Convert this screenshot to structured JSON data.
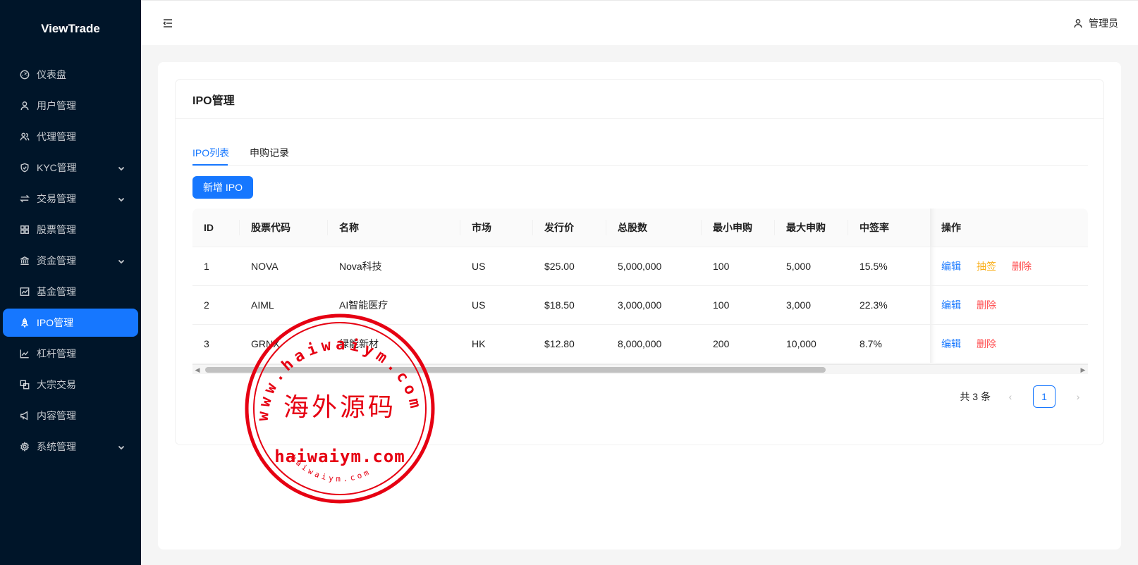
{
  "app": {
    "logo": "ViewTrade"
  },
  "sidebar": {
    "items": [
      {
        "label": "仪表盘",
        "icon": "dashboard-icon",
        "expandable": false,
        "active": false
      },
      {
        "label": "用户管理",
        "icon": "user-icon",
        "expandable": false,
        "active": false
      },
      {
        "label": "代理管理",
        "icon": "agent-icon",
        "expandable": false,
        "active": false
      },
      {
        "label": "KYC管理",
        "icon": "shield-icon",
        "expandable": true,
        "active": false
      },
      {
        "label": "交易管理",
        "icon": "swap-icon",
        "expandable": true,
        "active": false
      },
      {
        "label": "股票管理",
        "icon": "grid-icon",
        "expandable": false,
        "active": false
      },
      {
        "label": "资金管理",
        "icon": "bank-icon",
        "expandable": true,
        "active": false
      },
      {
        "label": "基金管理",
        "icon": "chart-icon",
        "expandable": false,
        "active": false
      },
      {
        "label": "IPO管理",
        "icon": "rocket-icon",
        "expandable": false,
        "active": true
      },
      {
        "label": "杠杆管理",
        "icon": "line-chart-icon",
        "expandable": false,
        "active": false
      },
      {
        "label": "大宗交易",
        "icon": "block-icon",
        "expandable": false,
        "active": false
      },
      {
        "label": "内容管理",
        "icon": "notification-icon",
        "expandable": false,
        "active": false
      },
      {
        "label": "系统管理",
        "icon": "setting-icon",
        "expandable": true,
        "active": false
      }
    ]
  },
  "header": {
    "user_label": "管理员"
  },
  "page": {
    "title": "IPO管理",
    "tabs": [
      "IPO列表",
      "申购记录"
    ],
    "add_button": "新增 IPO"
  },
  "table": {
    "columns": [
      "ID",
      "股票代码",
      "名称",
      "市场",
      "发行价",
      "总股数",
      "最小申购",
      "最大申购",
      "中签率",
      "操作"
    ],
    "rows": [
      {
        "cells": [
          "1",
          "NOVA",
          "Nova科技",
          "US",
          "$25.00",
          "5,000,000",
          "100",
          "5,000",
          "15.5%"
        ],
        "actions": [
          "编辑",
          "抽签",
          "删除"
        ]
      },
      {
        "cells": [
          "2",
          "AIML",
          "AI智能医疗",
          "US",
          "$18.50",
          "3,000,000",
          "100",
          "3,000",
          "22.3%"
        ],
        "actions": [
          "编辑",
          "删除"
        ]
      },
      {
        "cells": [
          "3",
          "GRNX",
          "绿能新材",
          "HK",
          "$12.80",
          "8,000,000",
          "200",
          "10,000",
          "8.7%"
        ],
        "actions": [
          "编辑",
          "删除"
        ]
      }
    ]
  },
  "pagination": {
    "total_text": "共 3 条",
    "current_page": "1"
  },
  "watermark": {
    "text_main": "海外源码",
    "text_url": "haiwaiym.com",
    "text_ring": "www.haiwaiym.com",
    "text_small": "haiwaiym.com",
    "color": "#e60012"
  }
}
